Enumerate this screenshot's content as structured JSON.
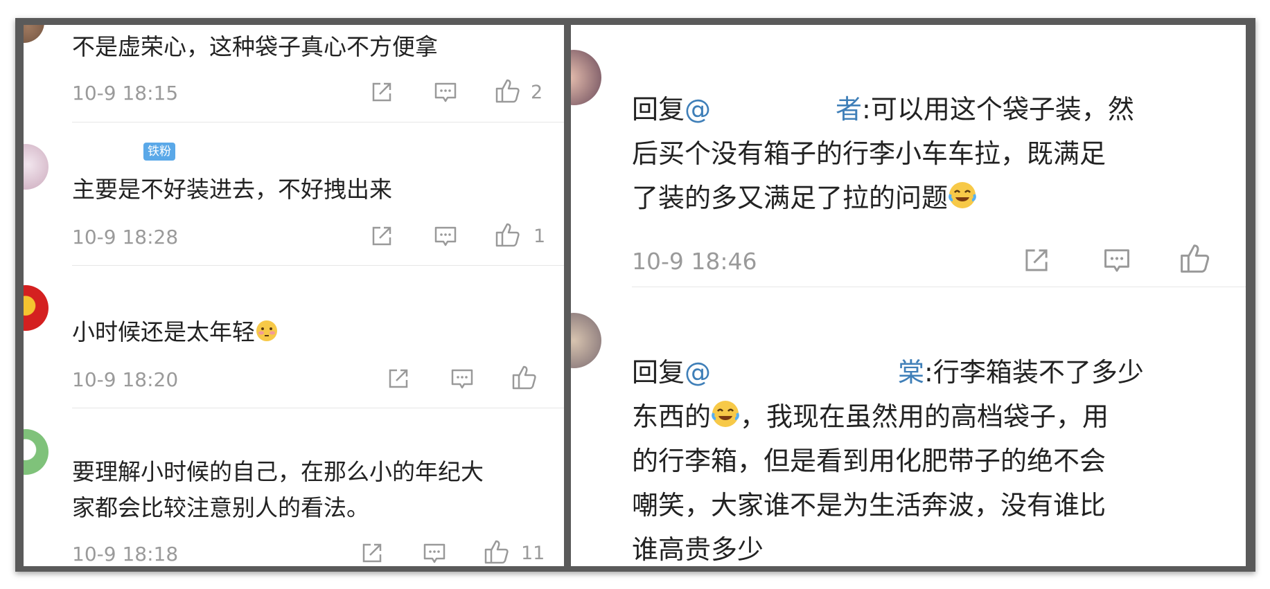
{
  "left_panel": {
    "comments": [
      {
        "text": "不是虚荣心，这种袋子真心不方便拿",
        "time": "10-9 18:15",
        "likes": "2"
      },
      {
        "badge": "铁粉",
        "text": "主要是不好装进去，不好拽出来",
        "time": "10-9 18:28",
        "likes": "1"
      },
      {
        "text": "小时候还是太年轻",
        "time": "10-9 18:20",
        "likes": ""
      },
      {
        "text_line1": "要理解小时候的自己，在那么小的年纪大",
        "text_line2": "家都会比较注意别人的看法。",
        "time": "10-9 18:18",
        "likes": "11"
      }
    ]
  },
  "right_panel": {
    "comments": [
      {
        "reply_prefix": "回复",
        "mention_at": "@",
        "mention_tail": "者",
        "line1_rest": ":可以用这个袋子装，然",
        "line2": "后买个没有箱子的行李小车车拉，既满足",
        "line3": "了装的多又满足了拉的问题",
        "time": "10-9 18:46"
      },
      {
        "reply_prefix": "回复",
        "mention_at": "@",
        "mention_tail": "棠",
        "line1_rest": ":行李箱装不了多少",
        "line2_a": "东西的",
        "line2_b": "，我现在虽然用的高档袋子，用",
        "line3": "的行李箱，但是看到用化肥带子的绝不会",
        "line4": "嘲笑，大家谁不是为生活奔波，没有谁比",
        "line5": "谁高贵多少"
      }
    ]
  },
  "icons": [
    "share-icon",
    "comment-icon",
    "thumbs-up-icon",
    "laughing-crying-emoji",
    "blushing-emoji"
  ],
  "colors": {
    "frame": "#5a5a5a",
    "text": "#222222",
    "meta": "#9a9a9a",
    "mention": "#3f7fb8",
    "badge": "#5aa8e8"
  }
}
